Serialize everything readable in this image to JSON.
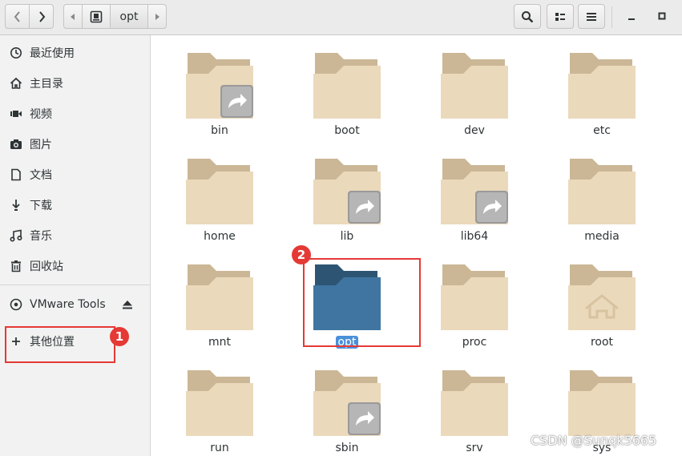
{
  "header": {
    "path_current": "opt"
  },
  "sidebar": {
    "items": [
      {
        "label": "最近使用",
        "icon": "clock-icon"
      },
      {
        "label": "主目录",
        "icon": "home-icon"
      },
      {
        "label": "视频",
        "icon": "video-icon"
      },
      {
        "label": "图片",
        "icon": "camera-icon"
      },
      {
        "label": "文档",
        "icon": "document-icon"
      },
      {
        "label": "下载",
        "icon": "download-icon"
      },
      {
        "label": "音乐",
        "icon": "music-icon"
      },
      {
        "label": "回收站",
        "icon": "trash-icon"
      }
    ],
    "device": {
      "label": "VMware Tools",
      "icon": "disc-icon"
    },
    "other": {
      "label": "其他位置",
      "icon": "plus-icon"
    }
  },
  "files": [
    {
      "name": "bin",
      "link": true
    },
    {
      "name": "boot",
      "link": false
    },
    {
      "name": "dev",
      "link": false
    },
    {
      "name": "etc",
      "link": false
    },
    {
      "name": "home",
      "link": false
    },
    {
      "name": "lib",
      "link": true
    },
    {
      "name": "lib64",
      "link": true
    },
    {
      "name": "media",
      "link": false
    },
    {
      "name": "mnt",
      "link": false
    },
    {
      "name": "opt",
      "link": false,
      "selected": true
    },
    {
      "name": "proc",
      "link": false
    },
    {
      "name": "root",
      "link": false,
      "home": true
    },
    {
      "name": "run",
      "link": false
    },
    {
      "name": "sbin",
      "link": true
    },
    {
      "name": "srv",
      "link": false
    },
    {
      "name": "sys",
      "link": false
    }
  ],
  "annotations": {
    "badge1": "1",
    "badge2": "2"
  },
  "watermark": "CSDN @Sunqk5665",
  "colors": {
    "folder_tab": "#cbb796",
    "folder_body": "#ebd9bc",
    "folder_selected_tab": "#2d5573",
    "folder_selected_body": "#3f75a0",
    "annotation": "#e53935",
    "selection": "#4a90d9"
  }
}
